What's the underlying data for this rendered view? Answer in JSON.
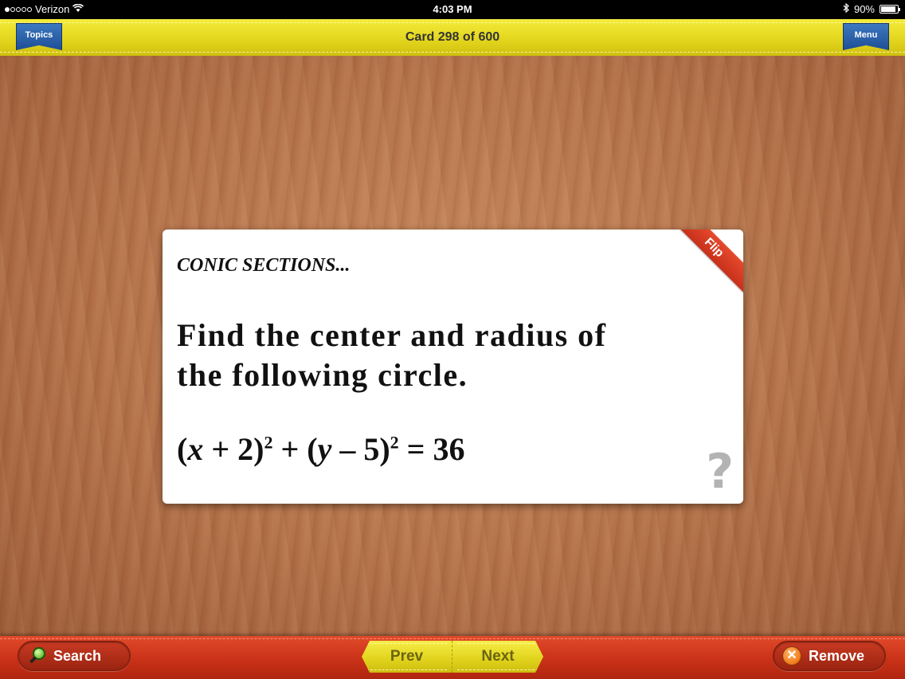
{
  "status_bar": {
    "carrier": "Verizon",
    "time": "4:03 PM",
    "battery": "90%"
  },
  "top_bar": {
    "topics_label": "Topics",
    "title": "Card 298 of 600",
    "menu_label": "Menu"
  },
  "card": {
    "topic": "CONIC SECTIONS...",
    "question_line1": "Find the center and radius of",
    "question_line2": "the following circle.",
    "equation": {
      "open1": "(",
      "var1": "x",
      "plus_two": " + 2)",
      "exp1": "2",
      "plus": " + (",
      "var2": "y",
      "minus_five": " – 5)",
      "exp2": "2",
      "equals": " = 36"
    },
    "flip_label": "Flip",
    "help_glyph": "?"
  },
  "bottom_bar": {
    "search_label": "Search",
    "prev_label": "Prev",
    "next_label": "Next",
    "remove_label": "Remove",
    "remove_glyph": "✕"
  },
  "colors": {
    "top_bar": "#e2d41c",
    "bottom_bar": "#c93218",
    "ribbon": "#1e4f96",
    "flip": "#d63a22",
    "wood": "#b4724a"
  }
}
